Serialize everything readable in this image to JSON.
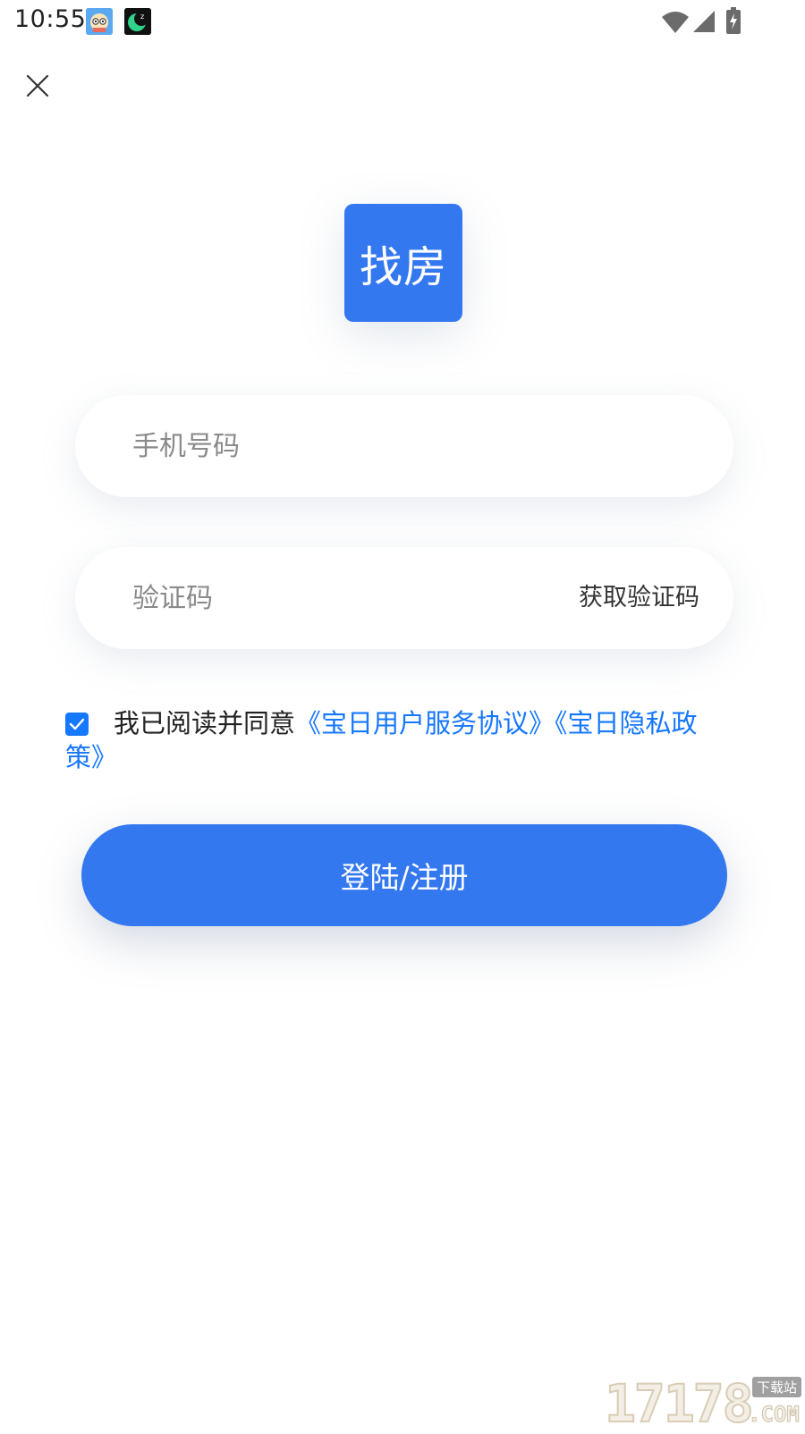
{
  "status_bar": {
    "time": "10:55",
    "icons": [
      "app-avatar-icon",
      "moon-app-icon",
      "wifi-icon",
      "signal-icon",
      "battery-charging-icon"
    ]
  },
  "header": {
    "close_icon": "close-icon"
  },
  "logo": {
    "text": "找房",
    "color": "#3478f0"
  },
  "form": {
    "phone_placeholder": "手机号码",
    "phone_value": "",
    "code_placeholder": "验证码",
    "code_value": "",
    "get_code_label": "获取验证码"
  },
  "agreement": {
    "checked": true,
    "prefix": "我已阅读并同意",
    "link_service": "《宝日用户服务协议》",
    "link_privacy": "《宝日隐私政策》",
    "link_color": "#1677ff"
  },
  "login_button": {
    "label": "登陆/注册",
    "color": "#3478f0"
  },
  "watermark": {
    "number": "17178",
    "tag": "下载站",
    "suffix": ".COM"
  }
}
